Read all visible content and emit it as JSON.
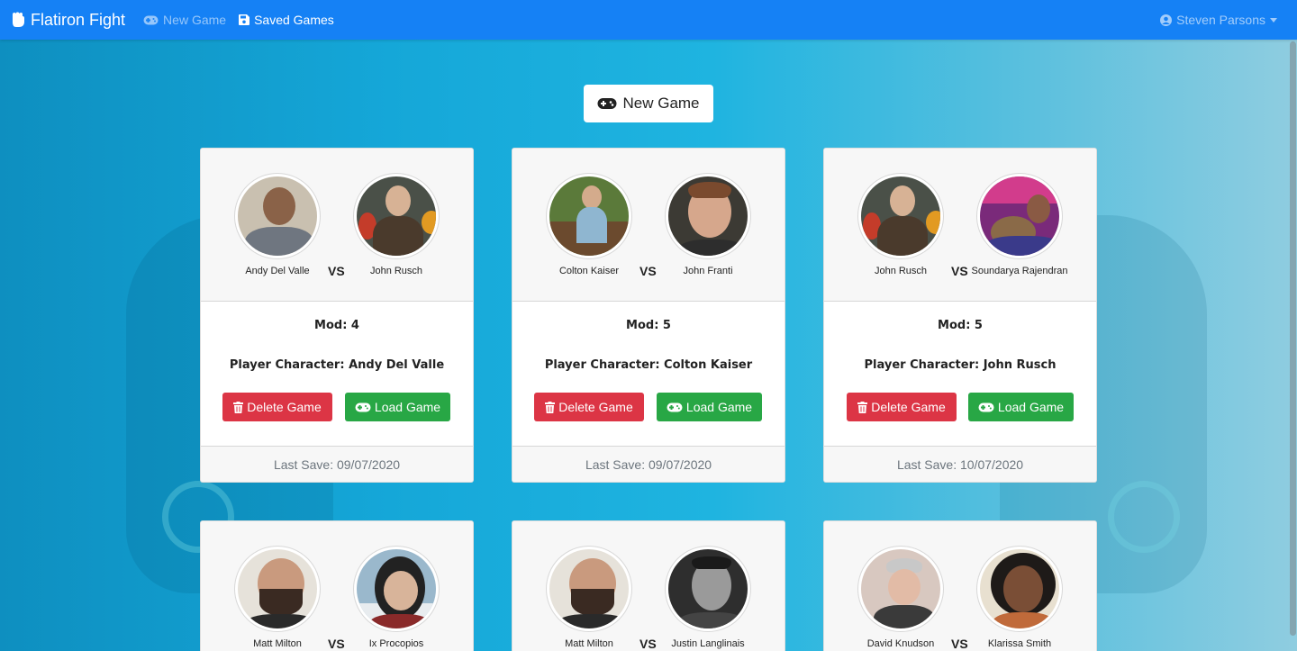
{
  "navbar": {
    "brand": "Flatiron Fight",
    "links": [
      {
        "label": "New Game",
        "icon": "gamepad-icon",
        "active": false
      },
      {
        "label": "Saved Games",
        "icon": "save-icon",
        "active": true
      }
    ],
    "user": {
      "label": "Steven Parsons",
      "icon": "user-circle-icon"
    }
  },
  "main": {
    "new_game_label": "New Game",
    "games": [
      {
        "player1": "Andy Del Valle",
        "player2": "John Rusch",
        "vs": "VS",
        "mod": "Mod: 4",
        "character": "Player Character: Andy Del Valle",
        "delete_label": "Delete Game",
        "load_label": "Load Game",
        "last_save": "Last Save: 09/07/2020"
      },
      {
        "player1": "Colton Kaiser",
        "player2": "John Franti",
        "vs": "VS",
        "mod": "Mod: 5",
        "character": "Player Character: Colton Kaiser",
        "delete_label": "Delete Game",
        "load_label": "Load Game",
        "last_save": "Last Save: 09/07/2020"
      },
      {
        "player1": "John Rusch",
        "player2": "Soundarya Rajendran",
        "vs": "VS",
        "mod": "Mod: 5",
        "character": "Player Character: John Rusch",
        "delete_label": "Delete Game",
        "load_label": "Load Game",
        "last_save": "Last Save: 10/07/2020"
      },
      {
        "player1": "Matt Milton",
        "player2": "Ix Procopios",
        "vs": "VS"
      },
      {
        "player1": "Matt Milton",
        "player2": "Justin Langlinais",
        "vs": "VS"
      },
      {
        "player1": "David Knudson",
        "player2": "Klarissa Smith",
        "vs": "VS"
      }
    ]
  },
  "colors": {
    "navbar": "#1581f5",
    "danger": "#dc3545",
    "success": "#28a745"
  }
}
